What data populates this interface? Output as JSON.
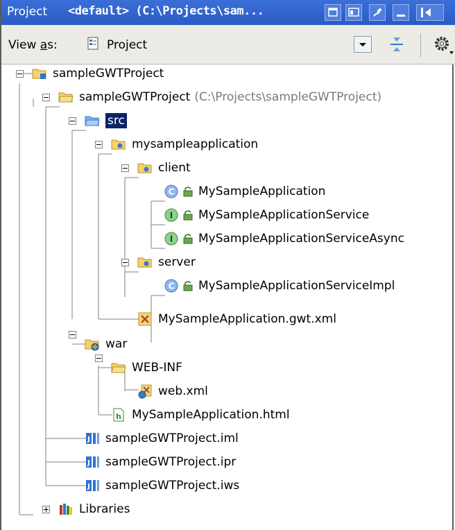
{
  "titlebar": {
    "panel_name": "Project",
    "scope": "<default> (C:\\Projects\\sam...",
    "colors": {
      "background": "#2f61cc",
      "text": "#ffffff"
    },
    "buttons": [
      "restore-icon",
      "layout-icon",
      "pin-icon",
      "minimize-icon",
      "hide-icon"
    ]
  },
  "toolbar": {
    "view_as_prefix": "View ",
    "view_as_accel": "a",
    "view_as_suffix": "s:",
    "view_mode": "Project",
    "icons": [
      "project-view-icon",
      "dropdown-arrow-icon",
      "collapse-all-icon",
      "settings-gear-icon"
    ]
  },
  "tree": {
    "root": {
      "label": "sampleGWTProject",
      "icon": "project-folder-icon",
      "expanded": true
    },
    "module": {
      "label": "sampleGWTProject",
      "path": "(C:\\Projects\\sampleGWTProject)",
      "icon": "module-folder-icon"
    },
    "src": {
      "label": "src",
      "icon": "source-folder-icon",
      "selected": true
    },
    "package": {
      "label": "mysampleapplication",
      "icon": "package-icon"
    },
    "client": {
      "label": "client",
      "icon": "package-icon"
    },
    "client_items": [
      {
        "label": "MySampleApplication",
        "kind": "class",
        "icon": "class-icon"
      },
      {
        "label": "MySampleApplicationService",
        "kind": "interface",
        "icon": "interface-icon"
      },
      {
        "label": "MySampleApplicationServiceAsync",
        "kind": "interface",
        "icon": "interface-icon"
      }
    ],
    "server": {
      "label": "server",
      "icon": "package-icon"
    },
    "server_items": [
      {
        "label": "MySampleApplicationServiceImpl",
        "kind": "class",
        "icon": "class-icon"
      }
    ],
    "gwt_xml": {
      "label": "MySampleApplication.gwt.xml",
      "icon": "xml-file-icon"
    },
    "war": {
      "label": "war",
      "icon": "web-folder-icon"
    },
    "webinf": {
      "label": "WEB-INF",
      "icon": "folder-icon"
    },
    "webxml": {
      "label": "web.xml",
      "icon": "web-xml-icon"
    },
    "html": {
      "label": "MySampleApplication.html",
      "icon": "html-file-icon"
    },
    "files": [
      {
        "label": "sampleGWTProject.iml",
        "icon": "idea-file-icon"
      },
      {
        "label": "sampleGWTProject.ipr",
        "icon": "idea-file-icon"
      },
      {
        "label": "sampleGWTProject.iws",
        "icon": "idea-file-icon"
      }
    ],
    "libraries": {
      "label": "Libraries",
      "icon": "libraries-icon",
      "expanded": false
    },
    "colors": {
      "selection": "#0a246a",
      "path_text": "#7a7a7a",
      "tree_lines": "#808080"
    }
  }
}
